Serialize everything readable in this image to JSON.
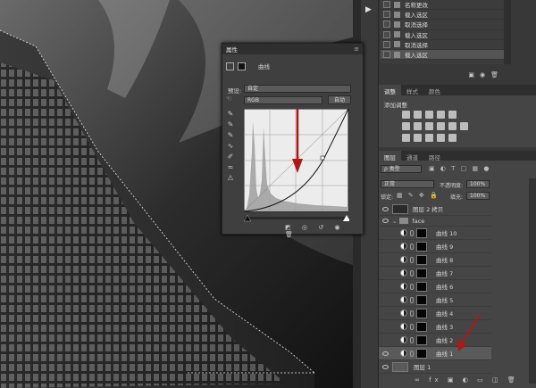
{
  "history": {
    "items": [
      {
        "label": "名称更改"
      },
      {
        "label": "载入选区"
      },
      {
        "label": "取消选择"
      },
      {
        "label": "载入选区"
      },
      {
        "label": "取消选择"
      },
      {
        "label": "载入选区"
      }
    ]
  },
  "properties": {
    "title": "属性",
    "subtitle": "曲线",
    "preset_label": "预设:",
    "preset_value": "自定",
    "channel_value": "RGB",
    "auto_label": "自动"
  },
  "adjustments": {
    "tabs": [
      "调整",
      "样式",
      "颜色"
    ],
    "add_label": "添加调整"
  },
  "layers_panel": {
    "tabs": [
      "图层",
      "通道",
      "路径"
    ],
    "filter_value": "ρ 类型",
    "blend_mode": "正常",
    "opacity_label": "不透明度:",
    "opacity_value": "100%",
    "lock_label": "锁定:",
    "fill_label": "填充:",
    "fill_value": "100%",
    "rows": [
      {
        "label": "图层 2 拷贝"
      },
      {
        "label": "face"
      },
      {
        "label": "曲线 10"
      },
      {
        "label": "曲线 9"
      },
      {
        "label": "曲线 8"
      },
      {
        "label": "曲线 7"
      },
      {
        "label": "曲线 6"
      },
      {
        "label": "曲线 5"
      },
      {
        "label": "曲线 4"
      },
      {
        "label": "曲线 3"
      },
      {
        "label": "曲线 2"
      },
      {
        "label": "曲线 1"
      },
      {
        "label": "图层 1"
      }
    ]
  },
  "colors": {
    "annotation_arrow": "#b01818"
  }
}
